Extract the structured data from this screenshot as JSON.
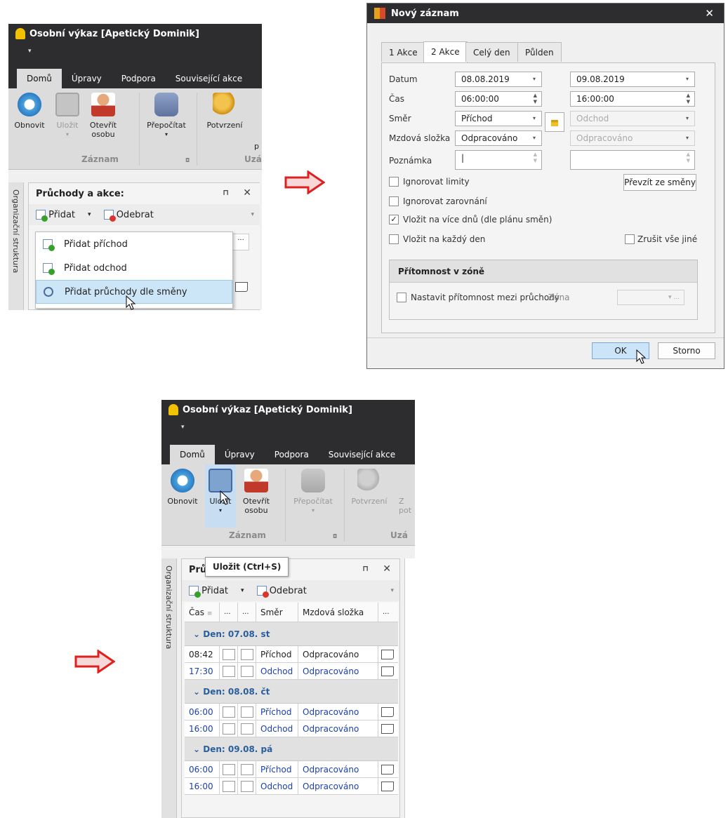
{
  "window": {
    "title": "Osobní výkaz [Apetický Dominik]",
    "strip_glyph": "▾",
    "tabs": [
      "Domů",
      "Úpravy",
      "Podpora",
      "Související akce"
    ]
  },
  "ribbon": {
    "refresh": "Obnovit",
    "save": "Uložit",
    "open_person_line1": "Otevřít",
    "open_person_line2": "osobu",
    "recalc": "Přepočítat",
    "confirm": "Potvrzení",
    "group_record": "Záznam",
    "group_close": "Uzá",
    "group_close_top1": "p",
    "next_label_top": "Z",
    "next_label_bottom": "pot",
    "group_expand_icon": "◘"
  },
  "panel": {
    "title": "Průchody a akce:",
    "title_short": "Prů",
    "pin": "⊓",
    "close": "✕",
    "add": "Přidat",
    "remove": "Odebrat",
    "sidetab": "Organizační struktura",
    "ellipsis": "..."
  },
  "menu": {
    "items": [
      "Přidat příchod",
      "Přidat odchod",
      "Přidat průchody dle směny"
    ]
  },
  "dialog": {
    "title": "Nový záznam",
    "tabs": [
      "1 Akce",
      "2 Akce",
      "Celý den",
      "Půlden"
    ],
    "labels": {
      "datum": "Datum",
      "cas": "Čas",
      "smer": "Směr",
      "mzdova": "Mzdová složka",
      "poznamka": "Poznámka"
    },
    "values": {
      "date_from": "08.08.2019",
      "date_to": "09.08.2019",
      "time_from": "06:00:00",
      "time_to": "16:00:00",
      "dir_from": "Příchod",
      "dir_to": "Odchod",
      "wage_from": "Odpracováno",
      "wage_to": "Odpracováno",
      "note_cursor": "|"
    },
    "checks": {
      "ignore_limits": "Ignorovat limity",
      "ignore_align": "Ignorovat zarovnání",
      "multi_days": "Vložit na více dnů (dle plánu směn)",
      "every_day": "Vložit na každý den",
      "cancel_other": "Zrušit vše jiné",
      "check_mark": "✓"
    },
    "take_shift": "Převzít ze směny",
    "presence_section": "Přítomnost v zóně",
    "presence_check": "Nastavit přítomnost mezi průchody",
    "zone": "Zóna",
    "zone_ellipsis": "▾ ...",
    "ok": "OK",
    "cancel": "Storno"
  },
  "tooltip": "Uložit (Ctrl+S)",
  "grid": {
    "headers": [
      "Čas",
      "...",
      "...",
      "Směr",
      "Mzdová složka",
      "..."
    ],
    "sort_icon": "≡",
    "groups": [
      {
        "label": "Den: 07.08. st",
        "rows": [
          {
            "time": "08:42",
            "dir": "Příchod",
            "wage": "Odpracováno",
            "blue": false
          },
          {
            "time": "17:30",
            "dir": "Odchod",
            "wage": "Odpracováno",
            "blue": true
          }
        ]
      },
      {
        "label": "Den: 08.08. čt",
        "rows": [
          {
            "time": "06:00",
            "dir": "Příchod",
            "wage": "Odpracováno",
            "blue": true
          },
          {
            "time": "16:00",
            "dir": "Odchod",
            "wage": "Odpracováno",
            "blue": true
          }
        ]
      },
      {
        "label": "Den: 09.08. pá",
        "rows": [
          {
            "time": "06:00",
            "dir": "Příchod",
            "wage": "Odpracováno",
            "blue": true
          },
          {
            "time": "16:00",
            "dir": "Odchod",
            "wage": "Odpracováno",
            "blue": true
          }
        ]
      }
    ]
  },
  "colors": {
    "arrow": "#e02020",
    "link_blue": "#1a3fb0",
    "dark": "#2d2d30"
  }
}
